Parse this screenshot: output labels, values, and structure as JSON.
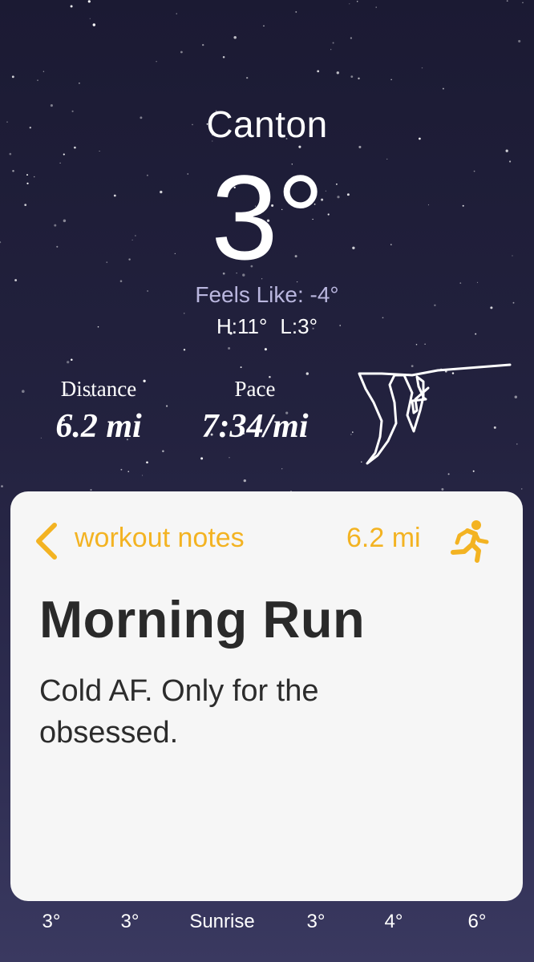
{
  "weather": {
    "city": "Canton",
    "temperature": "3°",
    "feels_like": "Feels Like: -4°",
    "high": "H:11°",
    "low": "L:3°"
  },
  "workout_stats": {
    "distance_label": "Distance",
    "distance_value": "6.2 mi",
    "pace_label": "Pace",
    "pace_value": "7:34/mi"
  },
  "notes_card": {
    "back_label": "workout notes",
    "distance": "6.2 mi",
    "title": "Morning Run",
    "body": "Cold AF. Only for the obsessed.",
    "accent_color": "#f3b322"
  },
  "hourly_forecast": [
    "3°",
    "3°",
    "Sunrise",
    "3°",
    "4°",
    "6°"
  ],
  "icons": {
    "back": "chevron-left-icon",
    "runner": "running-person-icon",
    "route": "route-map-icon"
  }
}
